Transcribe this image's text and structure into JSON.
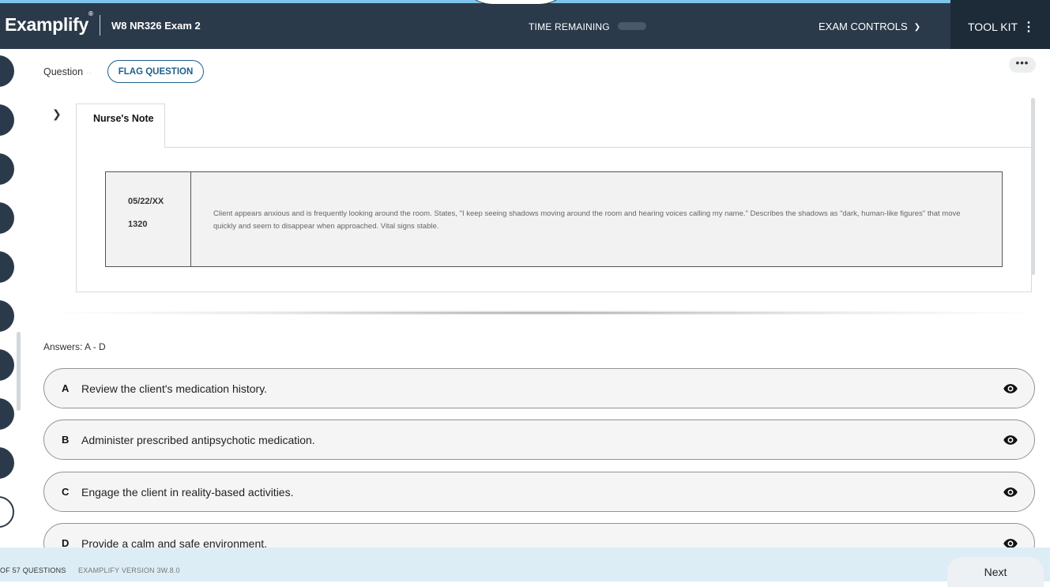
{
  "header": {
    "logo_text": "Examplify",
    "logo_mark": "®",
    "exam_title": "W8 NR326 Exam 2",
    "time_label": "TIME REMAINING",
    "exam_controls_label": "EXAM CONTROLS",
    "toolkit_label": "TOOL KIT",
    "colors": {
      "bar": "#2b3a4a",
      "toolkit": "#1d2a37",
      "accent_line": "#7fc4ea"
    }
  },
  "question": {
    "label": "Question",
    "flag_label": "FLAG QUESTION",
    "more_label": "•••"
  },
  "note": {
    "tab_label": "Nurse's Note",
    "date": "05/22/XX",
    "time": "1320",
    "text": "Client appears anxious and is frequently looking around the room. States, \"I keep seeing shadows moving around the room and hearing voices calling my name.\" Describes the shadows as \"dark, human-like figures\" that move quickly and seem to disappear when approached. Vital signs stable."
  },
  "answers": {
    "label": "Answers: A - D",
    "options": [
      {
        "letter": "A",
        "text": "Review the client's medication history."
      },
      {
        "letter": "B",
        "text": "Administer prescribed antipsychotic medication."
      },
      {
        "letter": "C",
        "text": "Engage the client in reality-based activities."
      },
      {
        "letter": "D",
        "text": "Provide a calm and safe environment."
      }
    ]
  },
  "footer": {
    "count_text": "OF 57 QUESTIONS",
    "version_text": "EXAMPLIFY VERSION 3W.8.0",
    "next_label": "Next"
  }
}
